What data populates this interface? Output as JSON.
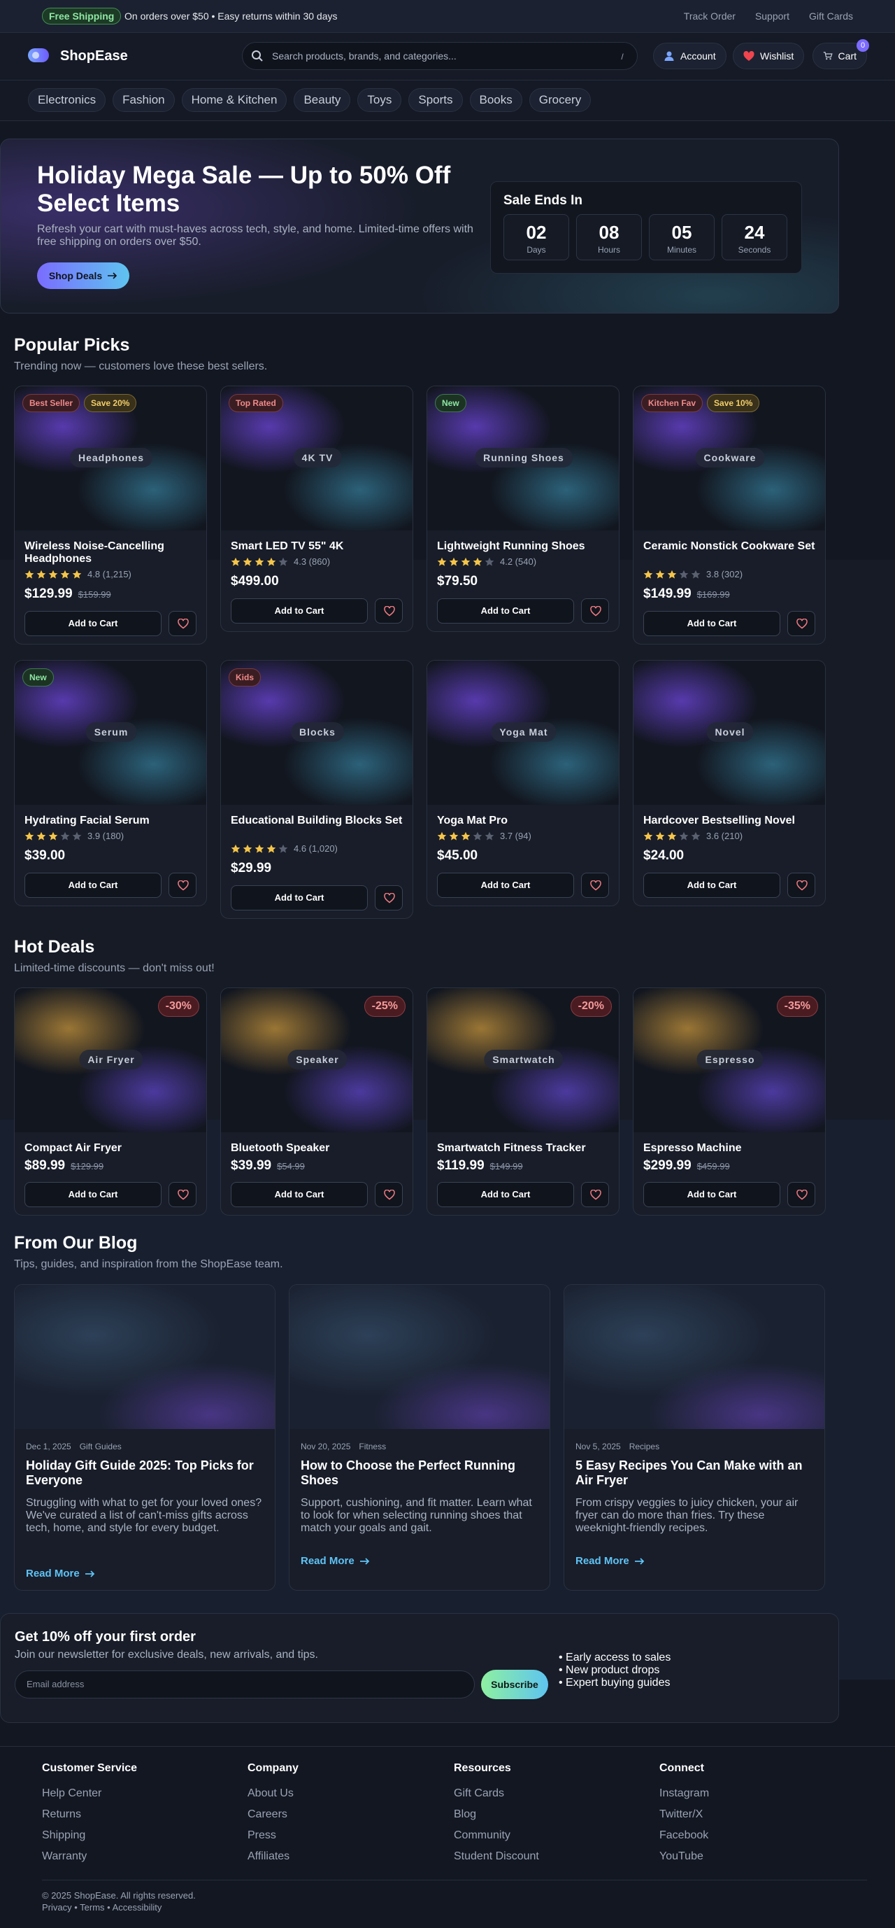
{
  "topbar": {
    "badge": "Free Shipping",
    "text": "On orders over $50 • Easy returns within 30 days",
    "links": [
      "Track Order",
      "Support",
      "Gift Cards"
    ]
  },
  "header": {
    "brand": "ShopEase",
    "search_placeholder": "Search products, brands, and categories...",
    "search_shortcut": "/",
    "account": "Account",
    "wishlist": "Wishlist",
    "cart": "Cart",
    "cart_count": "0"
  },
  "categories": [
    "Electronics",
    "Fashion",
    "Home & Kitchen",
    "Beauty",
    "Toys",
    "Sports",
    "Books",
    "Grocery"
  ],
  "hero": {
    "title": "Holiday Mega Sale — Up to 50% Off Select Items",
    "subtitle": "Refresh your cart with must-haves across tech, style, and home. Limited-time offers with free shipping on orders over $50.",
    "cta": "Shop Deals",
    "timer_title": "Sale Ends In",
    "timer": [
      {
        "num": "02",
        "label": "Days"
      },
      {
        "num": "08",
        "label": "Hours"
      },
      {
        "num": "05",
        "label": "Minutes"
      },
      {
        "num": "24",
        "label": "Seconds"
      }
    ]
  },
  "popular": {
    "title": "Popular Picks",
    "subtitle": "Trending now — customers love these best sellers.",
    "add_label": "Add to Cart",
    "products": [
      {
        "thumb": "Headphones",
        "name": "Wireless Noise-Cancelling Headphones",
        "rating": 4.8,
        "stars": 5,
        "reviews": "4.8 (1,215)",
        "price": "$129.99",
        "old": "$159.99",
        "badges": [
          {
            "t": "Best Seller",
            "c": "red"
          },
          {
            "t": "Save 20%",
            "c": "gold"
          }
        ]
      },
      {
        "thumb": "4K TV",
        "name": "Smart LED TV 55\" 4K",
        "rating": 4.3,
        "stars": 4,
        "reviews": "4.3 (860)",
        "price": "$499.00",
        "old": "",
        "badges": [
          {
            "t": "Top Rated",
            "c": "red"
          }
        ]
      },
      {
        "thumb": "Running Shoes",
        "name": "Lightweight Running Shoes",
        "rating": 4.2,
        "stars": 4,
        "reviews": "4.2 (540)",
        "price": "$79.50",
        "old": "",
        "badges": [
          {
            "t": "New",
            "c": "green"
          }
        ]
      },
      {
        "thumb": "Cookware",
        "name": "Ceramic Nonstick Cookware Set",
        "rating": 3.8,
        "stars": 3,
        "reviews": "3.8 (302)",
        "price": "$149.99",
        "old": "$169.99",
        "badges": [
          {
            "t": "Kitchen Fav",
            "c": "red"
          },
          {
            "t": "Save 10%",
            "c": "gold"
          }
        ]
      },
      {
        "thumb": "Serum",
        "name": "Hydrating Facial Serum",
        "rating": 3.9,
        "stars": 3,
        "reviews": "3.9 (180)",
        "price": "$39.00",
        "old": "",
        "badges": [
          {
            "t": "New",
            "c": "green"
          }
        ]
      },
      {
        "thumb": "Blocks",
        "name": "Educational Building Blocks Set",
        "rating": 4.6,
        "stars": 4,
        "reviews": "4.6 (1,020)",
        "price": "$29.99",
        "old": "",
        "badges": [
          {
            "t": "Kids",
            "c": "red"
          }
        ]
      },
      {
        "thumb": "Yoga Mat",
        "name": "Yoga Mat Pro",
        "rating": 3.7,
        "stars": 3,
        "reviews": "3.7 (94)",
        "price": "$45.00",
        "old": "",
        "badges": []
      },
      {
        "thumb": "Novel",
        "name": "Hardcover Bestselling Novel",
        "rating": 3.6,
        "stars": 3,
        "reviews": "3.6 (210)",
        "price": "$24.00",
        "old": "",
        "badges": []
      }
    ]
  },
  "deals": {
    "title": "Hot Deals",
    "subtitle": "Limited-time discounts — don't miss out!",
    "products": [
      {
        "thumb": "Air Fryer",
        "name": "Compact Air Fryer",
        "price": "$89.99",
        "old": "$129.99",
        "discount": "-30%"
      },
      {
        "thumb": "Speaker",
        "name": "Bluetooth Speaker",
        "price": "$39.99",
        "old": "$54.99",
        "discount": "-25%"
      },
      {
        "thumb": "Smartwatch",
        "name": "Smartwatch Fitness Tracker",
        "price": "$119.99",
        "old": "$149.99",
        "discount": "-20%"
      },
      {
        "thumb": "Espresso",
        "name": "Espresso Machine",
        "price": "$299.99",
        "old": "$459.99",
        "discount": "-35%"
      }
    ]
  },
  "blog": {
    "title": "From Our Blog",
    "subtitle": "Tips, guides, and inspiration from the ShopEase team.",
    "more": "Read More",
    "posts": [
      {
        "date": "Dec 1, 2025",
        "cat": "Gift Guides",
        "title": "Holiday Gift Guide 2025: Top Picks for Everyone",
        "excerpt": "Struggling with what to get for your loved ones? We've curated a list of can't-miss gifts across tech, home, and style for every budget."
      },
      {
        "date": "Nov 20, 2025",
        "cat": "Fitness",
        "title": "How to Choose the Perfect Running Shoes",
        "excerpt": "Support, cushioning, and fit matter. Learn what to look for when selecting running shoes that match your goals and gait."
      },
      {
        "date": "Nov 5, 2025",
        "cat": "Recipes",
        "title": "5 Easy Recipes You Can Make with an Air Fryer",
        "excerpt": "From crispy veggies to juicy chicken, your air fryer can do more than fries. Try these weeknight-friendly recipes."
      }
    ]
  },
  "newsletter": {
    "title": "Get 10% off your first order",
    "subtitle": "Join our newsletter for exclusive deals, new arrivals, and tips.",
    "placeholder": "Email address",
    "button": "Subscribe",
    "perks": [
      "• Early access to sales",
      "• New product drops",
      "• Expert buying guides"
    ]
  },
  "footer": {
    "columns": [
      {
        "head": "Customer Service",
        "links": [
          "Help Center",
          "Returns",
          "Shipping",
          "Warranty"
        ]
      },
      {
        "head": "Company",
        "links": [
          "About Us",
          "Careers",
          "Press",
          "Affiliates"
        ]
      },
      {
        "head": "Resources",
        "links": [
          "Gift Cards",
          "Blog",
          "Community",
          "Student Discount"
        ]
      },
      {
        "head": "Connect",
        "links": [
          "Instagram",
          "Twitter/X",
          "Facebook",
          "YouTube"
        ]
      }
    ],
    "copyright": "© 2025 ShopEase. All rights reserved.",
    "legal": "Privacy • Terms • Accessibility"
  },
  "colors": {
    "accent": "#7c6bff",
    "link": "#5fc3f5",
    "star": "#f5c54a",
    "star_off": "#5a6070",
    "badge_red": "#f08a8a",
    "badge_gold": "#f2cf6a",
    "badge_green": "#8ee6a2"
  },
  "icons": {
    "search": "search-icon",
    "account": "user-icon",
    "wishlist": "heart-icon",
    "cart": "cart-icon",
    "wish_button": "heart-outline-icon",
    "arrow": "arrow-right-icon",
    "star": "star-icon"
  }
}
